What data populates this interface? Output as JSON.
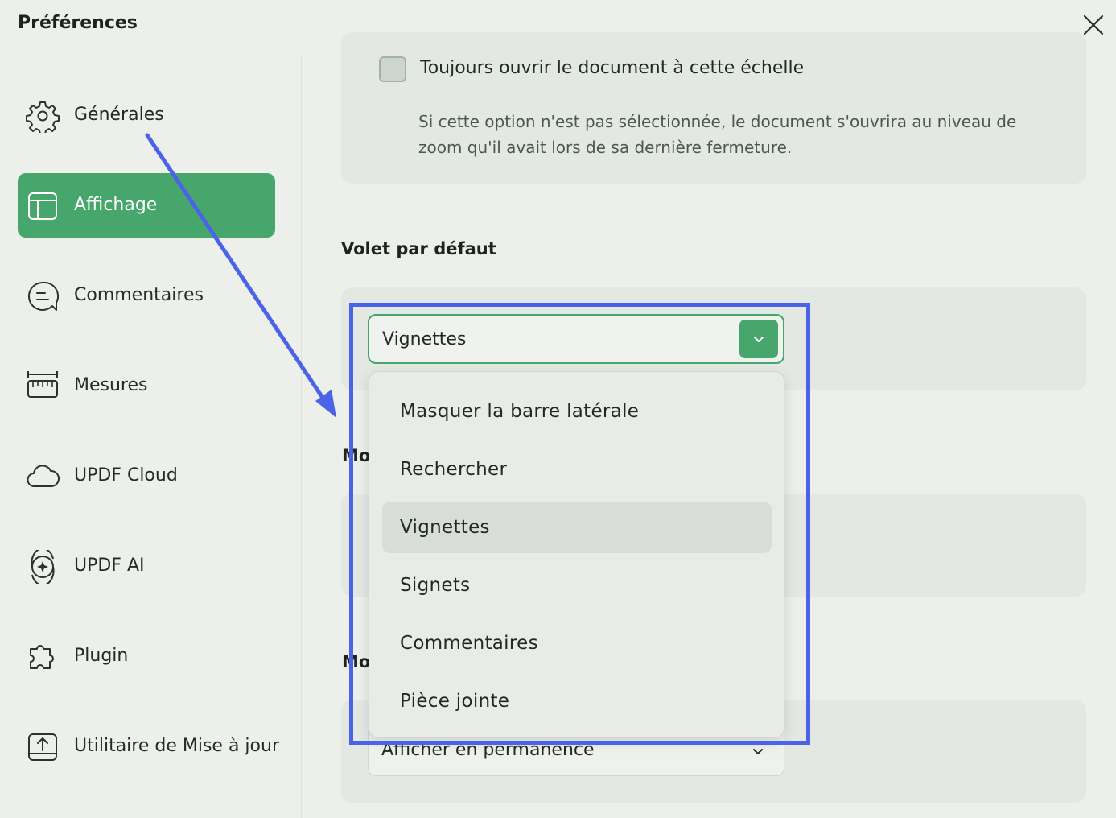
{
  "window": {
    "title": "Préférences"
  },
  "sidebar": {
    "items": [
      {
        "label": "Générales",
        "icon": "gear-icon"
      },
      {
        "label": "Affichage",
        "icon": "layout-icon",
        "active": true
      },
      {
        "label": "Commentaires",
        "icon": "comment-icon"
      },
      {
        "label": "Mesures",
        "icon": "ruler-icon"
      },
      {
        "label": "UPDF Cloud",
        "icon": "cloud-icon"
      },
      {
        "label": "UPDF AI",
        "icon": "ai-icon"
      },
      {
        "label": "Plugin",
        "icon": "puzzle-icon"
      },
      {
        "label": "Utilitaire de Mise à jour",
        "icon": "update-icon"
      }
    ]
  },
  "main": {
    "zoom_option": {
      "checkbox_label": "Toujours ouvrir le document à cette échelle",
      "checked": false,
      "description": "Si cette option n'est pas sélectionnée, le document s'ouvrira au niveau de zoom qu'il avait lors de sa dernière fermeture."
    },
    "default_pane": {
      "title": "Volet par défaut",
      "selected": "Vignettes",
      "options": [
        "Masquer la barre latérale",
        "Rechercher",
        "Vignettes",
        "Signets",
        "Commentaires",
        "Pièce jointe"
      ]
    },
    "hidden_section_1_partial": "Mo",
    "hidden_section_2_partial": "Mo",
    "bottom_select": {
      "value": "Afficher en permanence"
    }
  },
  "colors": {
    "accent": "#46a66b",
    "annotation": "#4a63e8",
    "background": "#ecefea"
  }
}
